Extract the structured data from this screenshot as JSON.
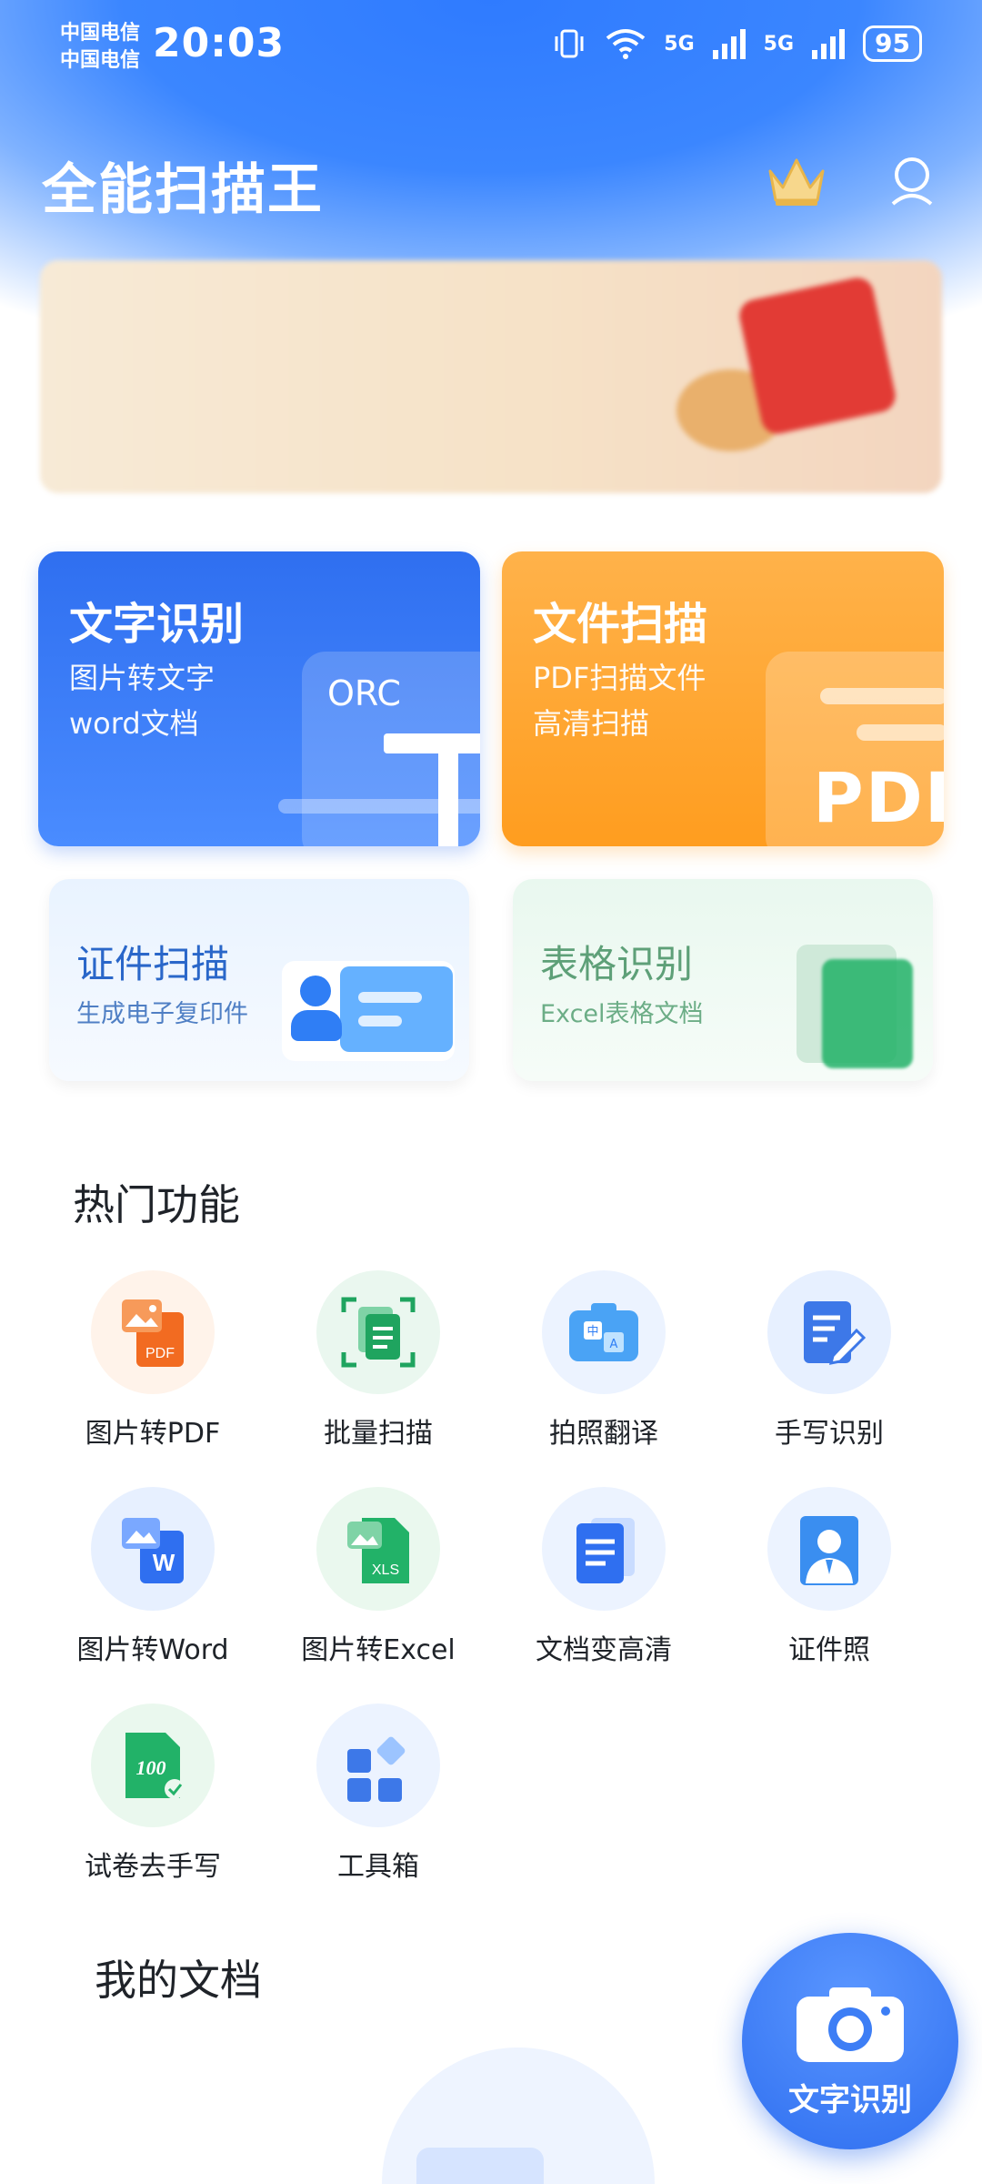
{
  "status_bar": {
    "carrier1": "中国电信",
    "carrier2": "中国电信",
    "time": "20:03",
    "network1": "5G",
    "network2": "5G",
    "battery": "95"
  },
  "header": {
    "title": "全能扫描王",
    "vip_icon": "crown-icon",
    "profile_icon": "user-icon"
  },
  "main_cards": [
    {
      "title": "文字识别",
      "line1": "图片转文字",
      "line2": "word文档",
      "badge": "ORC",
      "color": "#2f6ff0"
    },
    {
      "title": "文件扫描",
      "line1": "PDF扫描文件",
      "line2": "高清扫描",
      "badge": "PDF",
      "color": "#ff9d1f"
    }
  ],
  "small_cards": [
    {
      "title": "证件扫描",
      "subtitle": "生成电子复印件",
      "color": "#2a67c9"
    },
    {
      "title": "表格识别",
      "subtitle": "Excel表格文档",
      "color": "#3b8a5a"
    }
  ],
  "hot_section": {
    "title": "热门功能",
    "items": [
      {
        "label": "图片转PDF",
        "icon": "image-to-pdf-icon"
      },
      {
        "label": "批量扫描",
        "icon": "batch-scan-icon"
      },
      {
        "label": "拍照翻译",
        "icon": "photo-translate-icon"
      },
      {
        "label": "手写识别",
        "icon": "handwriting-icon"
      },
      {
        "label": "图片转Word",
        "icon": "image-to-word-icon"
      },
      {
        "label": "图片转Excel",
        "icon": "image-to-excel-icon"
      },
      {
        "label": "文档变高清",
        "icon": "document-hd-icon"
      },
      {
        "label": "证件照",
        "icon": "id-photo-icon"
      },
      {
        "label": "试卷去手写",
        "icon": "exam-erase-icon"
      },
      {
        "label": "工具箱",
        "icon": "toolbox-icon"
      }
    ]
  },
  "docs_section": {
    "title": "我的文档"
  },
  "fab": {
    "label": "文字识别",
    "icon": "camera-icon"
  }
}
